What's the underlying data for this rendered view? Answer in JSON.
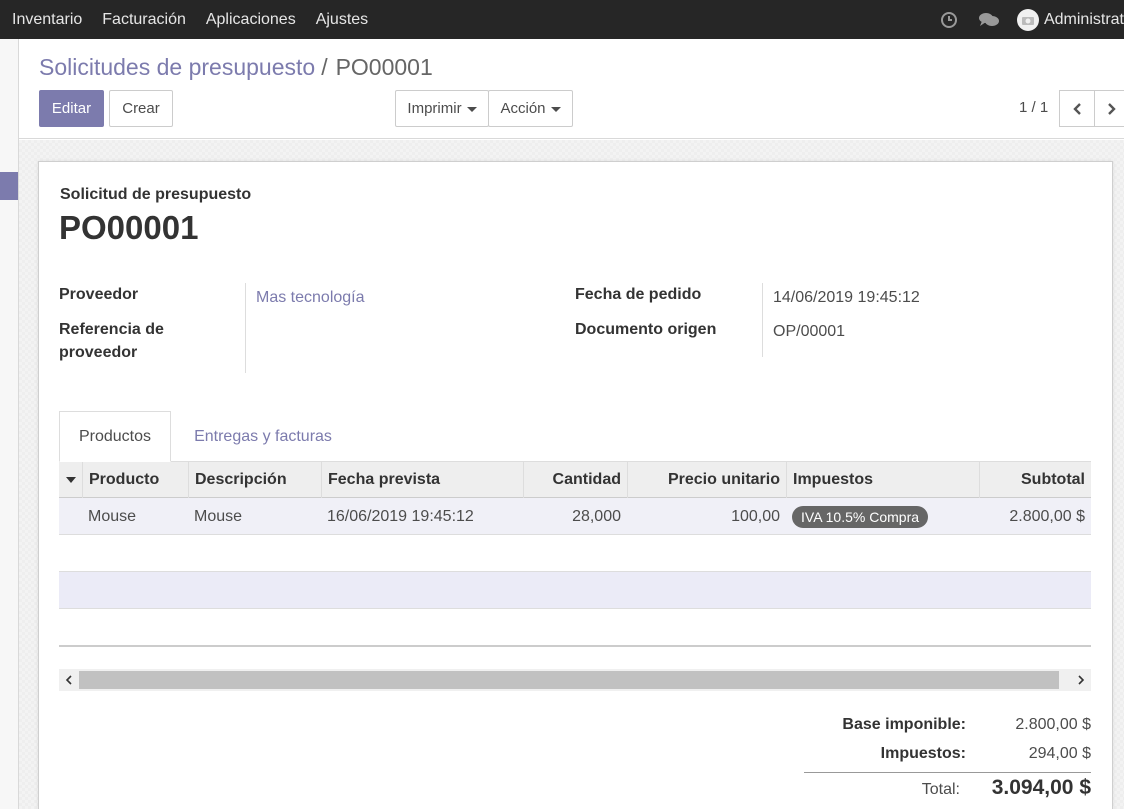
{
  "navbar": {
    "menu": [
      "Inventario",
      "Facturación",
      "Aplicaciones",
      "Ajustes"
    ],
    "user_name": "Administrat"
  },
  "breadcrumb": {
    "parent": "Solicitudes de presupuesto",
    "separator": "/",
    "current": "PO00001"
  },
  "buttons": {
    "edit": "Editar",
    "create": "Crear",
    "print": "Imprimir",
    "action": "Acción"
  },
  "pager": {
    "value": "1 / 1"
  },
  "document": {
    "type_label": "Solicitud de presupuesto",
    "name": "PO00001"
  },
  "fields": {
    "vendor_label": "Proveedor",
    "vendor_value": "Mas tecnología",
    "vendor_ref_label_1": "Referencia de",
    "vendor_ref_label_2": "proveedor",
    "order_date_label": "Fecha de pedido",
    "order_date_value": "14/06/2019 19:45:12",
    "source_label": "Documento origen",
    "source_value": "OP/00001"
  },
  "tabs": [
    "Productos",
    "Entregas y facturas"
  ],
  "table": {
    "headers": [
      "Producto",
      "Descripción",
      "Fecha prevista",
      "Cantidad",
      "Precio unitario",
      "Impuestos",
      "Subtotal"
    ],
    "rows": [
      {
        "product": "Mouse",
        "description": "Mouse",
        "date": "16/06/2019 19:45:12",
        "quantity": "28,000",
        "unit_price": "100,00",
        "tax": "IVA 10.5% Compra",
        "subtotal": "2.800,00 $"
      }
    ]
  },
  "totals": {
    "untaxed_label": "Base imponible:",
    "untaxed_value": "2.800,00 $",
    "taxes_label": "Impuestos:",
    "taxes_value": "294,00 $",
    "total_label": "Total:",
    "total_value": "3.094,00 $"
  },
  "colors": {
    "brand": "#7c7bad",
    "navbar": "#262626",
    "tag": "#666666"
  }
}
